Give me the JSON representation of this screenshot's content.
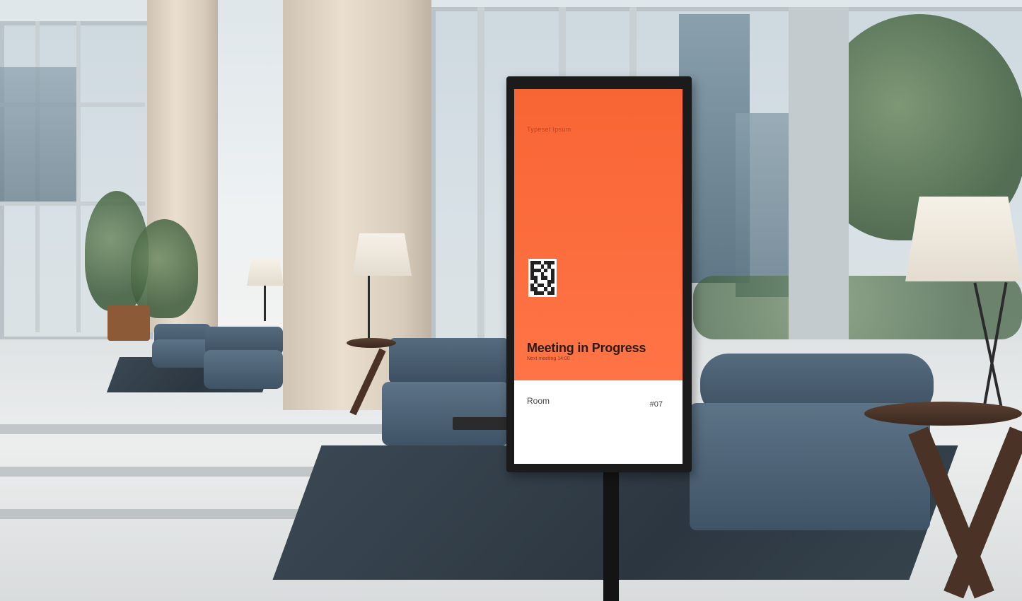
{
  "display": {
    "brand_text": "Typeset Ipsum",
    "status_title": "Meeting in Progress",
    "status_subtitle": "Next meeting 14:00",
    "room_label": "Room",
    "room_number": "#07"
  },
  "colors": {
    "screen_accent": "#ff6a3a",
    "screen_bottom": "#ffffff",
    "frame": "#1b1b1b"
  },
  "icons": {
    "qr": "qr-code-icon"
  }
}
